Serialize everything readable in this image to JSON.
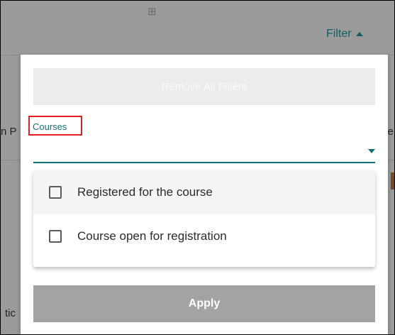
{
  "background": {
    "grid_icon": "⊞",
    "filter_label": "Filter",
    "left_fragment": "n P",
    "right_fragment": "ne",
    "bottom_fragment": "tic"
  },
  "filter_panel": {
    "remove_all_label": "Remove All Filters",
    "courses_label": "Courses",
    "options": [
      {
        "label": "Registered for the course",
        "checked": false
      },
      {
        "label": "Course open for registration",
        "checked": false
      }
    ],
    "apply_label": "Apply"
  },
  "colors": {
    "accent": "#137074",
    "highlight_box": "#e02020"
  }
}
